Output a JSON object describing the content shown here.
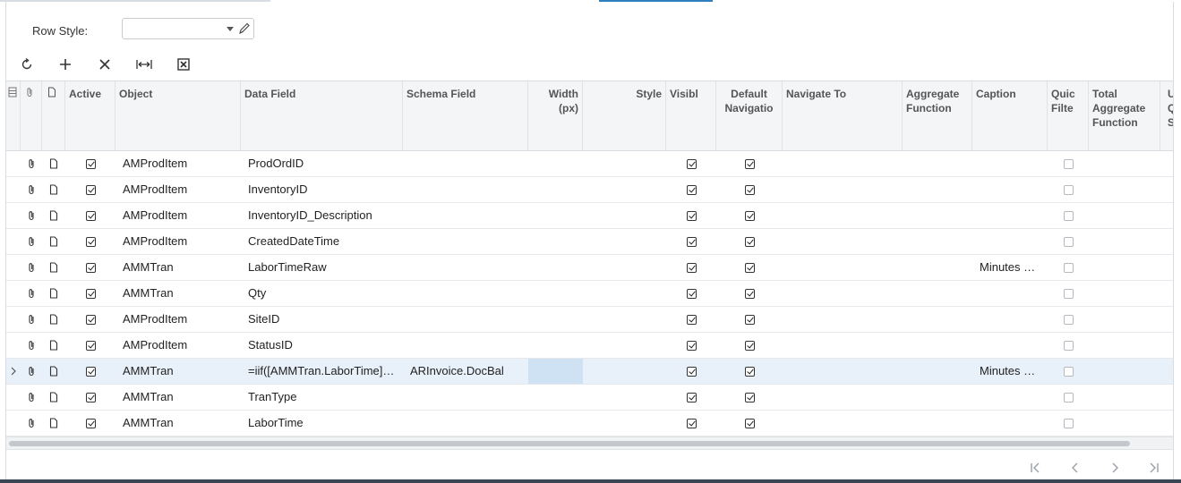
{
  "row_style": {
    "label": "Row Style:",
    "value": ""
  },
  "toolbar": {
    "refresh": "refresh-icon",
    "add": "plus-icon",
    "delete": "close-icon",
    "fit": "fit-columns-icon",
    "export": "excel-export-icon"
  },
  "columns": {
    "active": "Active",
    "object": "Object",
    "data_field": "Data Field",
    "schema_field": "Schema Field",
    "width": "Width (px)",
    "style": "Style",
    "visible": "Visibl",
    "default_nav": "Default Navigatio",
    "navigate_to": "Navigate To",
    "aggregate": "Aggregate Function",
    "caption": "Caption",
    "quick_filter": "Quic Filte",
    "total_aggregate": "Total Aggregate Function",
    "quick_search": "U Qu Se"
  },
  "rows": [
    {
      "active": true,
      "object": "AMProdItem",
      "data_field": "ProdOrdID",
      "schema_field": "",
      "width": "",
      "style": "",
      "visible": true,
      "default_nav": true,
      "navigate_to": "",
      "aggregate": "",
      "caption": "",
      "quick_filter": false,
      "total_aggregate": ""
    },
    {
      "active": true,
      "object": "AMProdItem",
      "data_field": "InventoryID",
      "schema_field": "",
      "width": "",
      "style": "",
      "visible": true,
      "default_nav": true,
      "navigate_to": "",
      "aggregate": "",
      "caption": "",
      "quick_filter": false,
      "total_aggregate": ""
    },
    {
      "active": true,
      "object": "AMProdItem",
      "data_field": "InventoryID_Description",
      "schema_field": "",
      "width": "",
      "style": "",
      "visible": true,
      "default_nav": true,
      "navigate_to": "",
      "aggregate": "",
      "caption": "",
      "quick_filter": false,
      "total_aggregate": ""
    },
    {
      "active": true,
      "object": "AMProdItem",
      "data_field": "CreatedDateTime",
      "schema_field": "",
      "width": "",
      "style": "",
      "visible": true,
      "default_nav": true,
      "navigate_to": "",
      "aggregate": "",
      "caption": "",
      "quick_filter": false,
      "total_aggregate": ""
    },
    {
      "active": true,
      "object": "AMMTran",
      "data_field": "LaborTimeRaw",
      "schema_field": "",
      "width": "",
      "style": "",
      "visible": true,
      "default_nav": true,
      "navigate_to": "",
      "aggregate": "",
      "caption": "Minutes …",
      "quick_filter": false,
      "total_aggregate": ""
    },
    {
      "active": true,
      "object": "AMMTran",
      "data_field": "Qty",
      "schema_field": "",
      "width": "",
      "style": "",
      "visible": true,
      "default_nav": true,
      "navigate_to": "",
      "aggregate": "",
      "caption": "",
      "quick_filter": false,
      "total_aggregate": ""
    },
    {
      "active": true,
      "object": "AMProdItem",
      "data_field": "SiteID",
      "schema_field": "",
      "width": "",
      "style": "",
      "visible": true,
      "default_nav": true,
      "navigate_to": "",
      "aggregate": "",
      "caption": "",
      "quick_filter": false,
      "total_aggregate": ""
    },
    {
      "active": true,
      "object": "AMProdItem",
      "data_field": "StatusID",
      "schema_field": "",
      "width": "",
      "style": "",
      "visible": true,
      "default_nav": true,
      "navigate_to": "",
      "aggregate": "",
      "caption": "",
      "quick_filter": false,
      "total_aggregate": ""
    },
    {
      "active": true,
      "object": "AMMTran",
      "data_field": "=iif([AMMTran.LaborTime]…",
      "schema_field": "ARInvoice.DocBal",
      "width": "",
      "style": "",
      "visible": true,
      "default_nav": true,
      "navigate_to": "",
      "aggregate": "",
      "caption": "Minutes …",
      "quick_filter": false,
      "total_aggregate": "",
      "selected": true
    },
    {
      "active": true,
      "object": "AMMTran",
      "data_field": "TranType",
      "schema_field": "",
      "width": "",
      "style": "",
      "visible": true,
      "default_nav": true,
      "navigate_to": "",
      "aggregate": "",
      "caption": "",
      "quick_filter": false,
      "total_aggregate": ""
    },
    {
      "active": true,
      "object": "AMMTran",
      "data_field": "LaborTime",
      "schema_field": "",
      "width": "",
      "style": "",
      "visible": true,
      "default_nav": true,
      "navigate_to": "",
      "aggregate": "",
      "caption": "",
      "quick_filter": false,
      "total_aggregate": ""
    }
  ],
  "pager": {
    "first": "first-page-icon",
    "prev": "prev-page-icon",
    "next": "next-page-icon",
    "last": "last-page-icon"
  }
}
